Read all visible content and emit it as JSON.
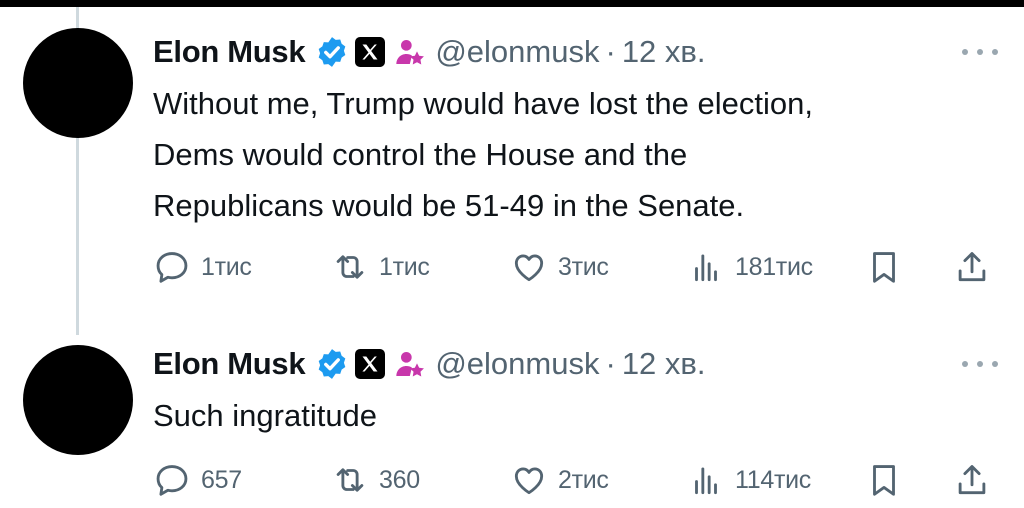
{
  "tweets": [
    {
      "author": {
        "name": "Elon Musk",
        "handle": "@elonmusk",
        "time": "12 хв."
      },
      "text_lines": [
        "Without me, Trump would have lost the election,",
        "Dems would control the House and the",
        "Republicans would be 51-49 in the Senate."
      ],
      "metrics": {
        "replies": "1тис",
        "reposts": "1тис",
        "likes": "3тис",
        "views": "181тис"
      }
    },
    {
      "author": {
        "name": "Elon Musk",
        "handle": "@elonmusk",
        "time": "12 хв."
      },
      "text_lines": [
        "Such ingratitude"
      ],
      "metrics": {
        "replies": "657",
        "reposts": "360",
        "likes": "2тис",
        "views": "114тис"
      }
    }
  ],
  "colors": {
    "verified": "#1d9bf0",
    "affiliate": "#c837ab",
    "muted": "#536471",
    "thread_line": "#cfd9de"
  },
  "icons": [
    "verified-icon",
    "x-badge-icon",
    "affiliate-icon",
    "more-icon",
    "reply-icon",
    "repost-icon",
    "like-icon",
    "views-icon",
    "bookmark-icon",
    "share-icon"
  ]
}
